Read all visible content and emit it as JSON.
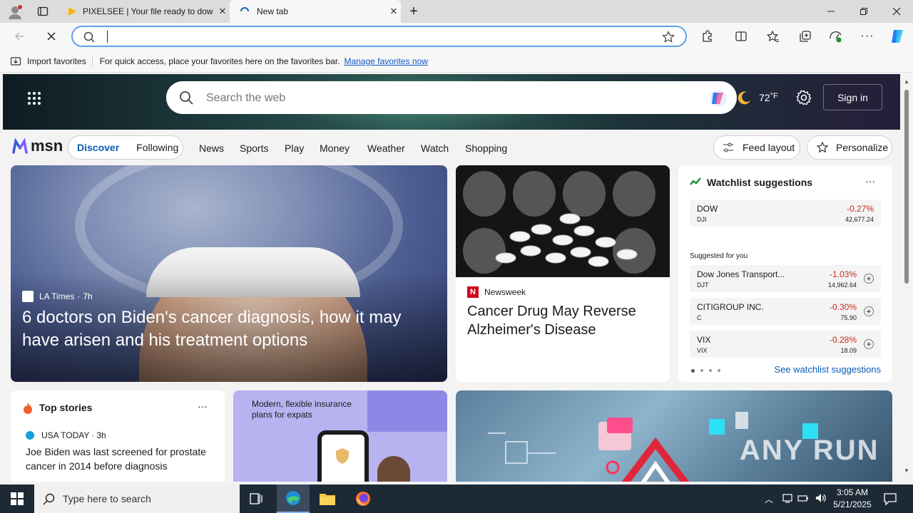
{
  "tabs": [
    {
      "title": "PIXELSEE | Your file ready to dow",
      "icon": "play-icon"
    },
    {
      "title": "New tab",
      "icon": "loading-icon"
    }
  ],
  "toolbar": {
    "address_value": ""
  },
  "favorites_bar": {
    "import_label": "Import favorites",
    "message": "For quick access, place your favorites here on the favorites bar.",
    "manage_link": "Manage favorites now"
  },
  "msn": {
    "search_placeholder": "Search the web",
    "weather_temp": "72",
    "weather_unit": "°F",
    "signin_label": "Sign in",
    "logo_text": "msn",
    "discover_label": "Discover",
    "following_label": "Following",
    "nav_items": [
      "News",
      "Sports",
      "Play",
      "Money",
      "Weather",
      "Watch",
      "Shopping"
    ],
    "feed_layout_label": "Feed layout",
    "personalize_label": "Personalize"
  },
  "main_story": {
    "source": "LA Times",
    "age": "7h",
    "headline": "6 doctors on Biden's cancer diagnosis, how it may have arisen and his treatment options"
  },
  "second_story": {
    "source": "Newsweek",
    "headline": "Cancer Drug May Reverse Alzheimer's Disease"
  },
  "watchlist": {
    "title": "Watchlist suggestions",
    "suggested_label": "Suggested for you",
    "see_link": "See watchlist suggestions",
    "main": {
      "name": "DOW",
      "symbol": "DJI",
      "change": "-0.27%",
      "price": "42,677.24"
    },
    "items": [
      {
        "name": "Dow Jones Transport...",
        "symbol": "DJT",
        "change": "-1.03%",
        "price": "14,962.64"
      },
      {
        "name": "CITIGROUP INC.",
        "symbol": "C",
        "change": "-0.30%",
        "price": "75.90"
      },
      {
        "name": "VIX",
        "symbol": "VIX",
        "change": "-0.28%",
        "price": "18.09"
      }
    ],
    "accent_negative": "#c42b1c"
  },
  "top_stories": {
    "title": "Top stories",
    "source": "USA TODAY",
    "age": "3h",
    "headline": "Joe Biden was last screened for prostate cancer in 2014 before diagnosis"
  },
  "ad": {
    "text": "Modern, flexible insurance plans for expats"
  },
  "watermark": "ANY RUN",
  "taskbar": {
    "search_placeholder": "Type here to search",
    "time": "3:05 AM",
    "date": "5/21/2025"
  }
}
